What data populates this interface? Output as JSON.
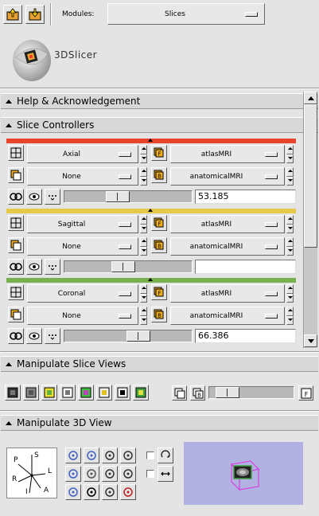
{
  "toolbar": {
    "modules_label": "Modules:",
    "module_value": "Slices"
  },
  "logo": {
    "text": "3DSlicer"
  },
  "panels": {
    "help": "Help & Acknowledgement",
    "slice_controllers": "Slice Controllers",
    "manipulate_slice_views": "Manipulate Slice Views",
    "manipulate_3d_view": "Manipulate 3D View"
  },
  "controllers": [
    {
      "color": "#e8442c",
      "orientation": "Axial",
      "label_layer": "None",
      "foreground": "atlasMRI",
      "background": "anatomicalMRI",
      "offset": "53.185",
      "slider_fraction": 0.4
    },
    {
      "color": "#e6c84a",
      "orientation": "Sagittal",
      "label_layer": "None",
      "foreground": "atlasMRI",
      "background": "anatomicalMRI",
      "offset": "",
      "slider_fraction": 0.45
    },
    {
      "color": "#78b050",
      "orientation": "Coronal",
      "label_layer": "None",
      "foreground": "atlasMRI",
      "background": "anatomicalMRI",
      "offset": "66.386",
      "slider_fraction": 0.6
    }
  ],
  "layer_badges": {
    "foreground": "F",
    "background": "B"
  },
  "manip_slice": {
    "b_label": "B",
    "f_label": "F",
    "slider_fraction": 0.1
  },
  "orientation_axes": {
    "s": "S",
    "p": "P",
    "l": "L",
    "r": "R",
    "i": "I",
    "a": "A"
  },
  "colors": {
    "panel_bg": "#e4e4e4",
    "view_bg": "#b2b2e2"
  }
}
